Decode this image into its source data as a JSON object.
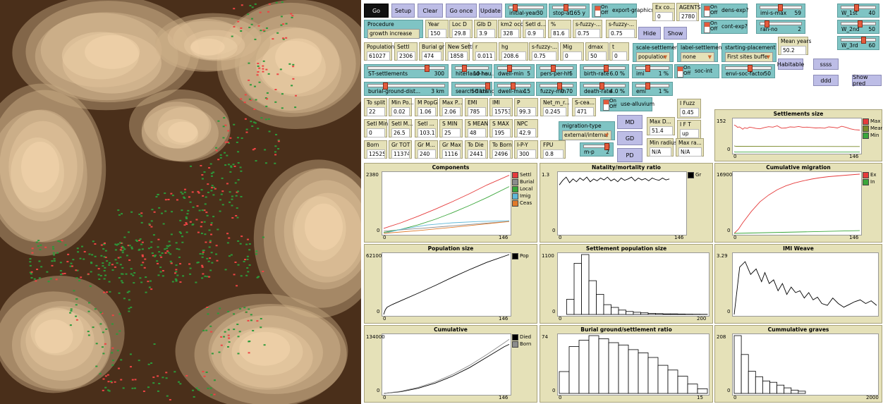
{
  "buttons": {
    "go": "Go",
    "setup": "Setup",
    "clear": "Clear",
    "go_once": "Go once",
    "update": "Update",
    "hide": "Hide",
    "show": "Show",
    "habitable": "Habitable",
    "ssss": "ssss",
    "ddd": "ddd",
    "show_pred": "Show pred",
    "md": "MD",
    "gd": "GD",
    "pd": "PD"
  },
  "switch_labels": {
    "on": "On",
    "off": "Off"
  },
  "sliders": [
    {
      "name": "initial-year",
      "value": "30",
      "frac": 0.1
    },
    {
      "name": "stop-at",
      "value": "165 y",
      "frac": 0.35
    },
    {
      "name": "imi-s-max",
      "value": "59",
      "frac": 0.45
    },
    {
      "name": "ran-no",
      "value": "2",
      "frac": 0.1
    },
    {
      "name": "W_1st",
      "value": "40",
      "frac": 0.4
    },
    {
      "name": "W_2nd",
      "value": "50",
      "frac": 0.5
    },
    {
      "name": "W_3rd",
      "value": "60",
      "frac": 0.6
    },
    {
      "name": "ST-settlements",
      "value": "300",
      "frac": 0.75
    },
    {
      "name": "hiterland-hou...",
      "value": "10 ha",
      "frac": 0.2
    },
    {
      "name": "dwell-min",
      "value": "5",
      "frac": 0.3
    },
    {
      "name": "pers-per-hh",
      "value": "5",
      "frac": 0.35
    },
    {
      "name": "birth-rate",
      "value": "6.0 %",
      "frac": 0.5
    },
    {
      "name": "imi",
      "value": "1 %",
      "frac": 0.3
    },
    {
      "name": "envi-soc-factor",
      "value": "50",
      "frac": 0.5
    },
    {
      "name": "burial-ground-dist...",
      "value": "3 km",
      "frac": 0.2
    },
    {
      "name": "search-distance",
      "value": "50 km",
      "frac": 0.95
    },
    {
      "name": "dwell-max",
      "value": "15",
      "frac": 0.4
    },
    {
      "name": "fuzzy-min",
      "value": "0.70",
      "frac": 0.55
    },
    {
      "name": "death-rate",
      "value": "4.0 %",
      "frac": 0.4
    },
    {
      "name": "emi",
      "value": "1 %",
      "frac": 0.3
    },
    {
      "name": "m-p",
      "value": "2",
      "frac": 0.85
    }
  ],
  "switches": [
    {
      "name": "export-graphics?"
    },
    {
      "name": "dens-exp?"
    },
    {
      "name": "cont-exp?"
    },
    {
      "name": "soc-int"
    },
    {
      "name": "use-alluvium"
    }
  ],
  "choosers": [
    {
      "label": "Procedure",
      "value": "growth increase"
    },
    {
      "label": "scale-settlements",
      "value": "population"
    },
    {
      "label": "label-settlements",
      "value": "none"
    },
    {
      "label": "starting-placement",
      "value": "First sites buffer"
    },
    {
      "label": "migration-type",
      "value": "external/internal"
    }
  ],
  "monitors": [
    {
      "label": "Ex co...",
      "value": "0"
    },
    {
      "label": "AGENTS",
      "value": "2780"
    },
    {
      "label": "Year",
      "value": "150"
    },
    {
      "label": "Loc D",
      "value": "29.8"
    },
    {
      "label": "Glb D",
      "value": "3.9"
    },
    {
      "label": "km2 occ",
      "value": "328"
    },
    {
      "label": "Setl d...",
      "value": "0.9"
    },
    {
      "label": "%",
      "value": "81.6"
    },
    {
      "label": "s-fuzzy-...",
      "value": "0.75"
    },
    {
      "label": "s-fuzzy-...",
      "value": "0.75"
    },
    {
      "label": "Mean years",
      "value": "50.2"
    },
    {
      "label": "Population",
      "value": "61027"
    },
    {
      "label": "Settl",
      "value": "2306"
    },
    {
      "label": "Burial gr",
      "value": "474"
    },
    {
      "label": "New Settl",
      "value": "1858"
    },
    {
      "label": "r",
      "value": "0.011"
    },
    {
      "label": "hg",
      "value": "208.6"
    },
    {
      "label": "s-fuzzy-...",
      "value": "0.75"
    },
    {
      "label": "Mig",
      "value": "0"
    },
    {
      "label": "dmax",
      "value": "50"
    },
    {
      "label": "t",
      "value": "0"
    },
    {
      "label": "I Fuzz",
      "value": "0.45"
    },
    {
      "label": "I F T",
      "value": "up"
    },
    {
      "label": "To split",
      "value": "22"
    },
    {
      "label": "Min Po...",
      "value": "0.02"
    },
    {
      "label": "M PopG",
      "value": "1.06"
    },
    {
      "label": "Max P...",
      "value": "2.06"
    },
    {
      "label": "EMI",
      "value": "785"
    },
    {
      "label": "IMI",
      "value": "15753"
    },
    {
      "label": "P",
      "value": "99.3"
    },
    {
      "label": "Net_m_r...",
      "value": "0.245"
    },
    {
      "label": "S-cea...",
      "value": "471"
    },
    {
      "label": "Setl Min",
      "value": "0"
    },
    {
      "label": "Setl M...",
      "value": "26.5"
    },
    {
      "label": "Setl ...",
      "value": "103.1"
    },
    {
      "label": "S MIN",
      "value": "25"
    },
    {
      "label": "S MEAN",
      "value": "48"
    },
    {
      "label": "S MAX",
      "value": "195"
    },
    {
      "label": "NPC",
      "value": "42.9"
    },
    {
      "label": "Max D...",
      "value": "51.4"
    },
    {
      "label": "Born",
      "value": "125258"
    },
    {
      "label": "Gr TOT",
      "value": "113746"
    },
    {
      "label": "Gr M...",
      "value": "240"
    },
    {
      "label": "Gr Max",
      "value": "1116"
    },
    {
      "label": "To Die",
      "value": "2441"
    },
    {
      "label": "To Born",
      "value": "2496"
    },
    {
      "label": "I-P-Y",
      "value": "300"
    },
    {
      "label": "FPU",
      "value": "0.8"
    },
    {
      "label": "Min radius",
      "value": "N/A"
    },
    {
      "label": "Max ra...",
      "value": "N/A"
    }
  ],
  "chart_data": [
    {
      "id": "settlements-size",
      "title": "Settlements size",
      "type": "line",
      "ymax": "152",
      "y0": "0",
      "x0": "0",
      "xmax": "146",
      "legend": [
        {
          "name": "Max",
          "color": "#e53b3b"
        },
        {
          "name": "Mean",
          "color": "#7a8a2a"
        },
        {
          "name": "Min",
          "color": "#3aa63a"
        }
      ],
      "series": [
        {
          "name": "Max",
          "color": "#e53b3b",
          "x": [
            0,
            2,
            4,
            6,
            8,
            10,
            12,
            15,
            18,
            22,
            25,
            30,
            35,
            40,
            45,
            50,
            55,
            60,
            65,
            70,
            75,
            80,
            85,
            90,
            95,
            100,
            105,
            110,
            115,
            120,
            125,
            130,
            135,
            140,
            146
          ],
          "y": [
            128,
            124,
            117,
            119,
            114,
            108,
            115,
            112,
            118,
            115,
            112,
            110,
            116,
            120,
            118,
            124,
            113,
            114,
            119,
            118,
            121,
            117,
            118,
            116,
            114,
            115,
            113,
            119,
            117,
            114,
            122,
            117,
            110,
            106,
            104
          ]
        },
        {
          "name": "Mean",
          "color": "#7a8a2a",
          "x": [
            0,
            2,
            146
          ],
          "y": [
            30,
            28,
            27
          ]
        },
        {
          "name": "Min",
          "color": "#3aa63a",
          "x": [
            0,
            1,
            146
          ],
          "y": [
            3,
            1,
            1
          ]
        }
      ]
    },
    {
      "id": "components",
      "title": "Components",
      "type": "line",
      "ymax": "2380",
      "y0": "0",
      "x0": "0",
      "xmax": "146",
      "legend": [
        {
          "name": "Settl",
          "color": "#e53b3b"
        },
        {
          "name": "Burial",
          "color": "#8c8c8c"
        },
        {
          "name": "Local",
          "color": "#3aa63a"
        },
        {
          "name": "Imig",
          "color": "#5fb8d8"
        },
        {
          "name": "Ceas",
          "color": "#e07a2a"
        }
      ],
      "series": [
        {
          "name": "Settl",
          "color": "#e53b3b",
          "x": [
            0,
            20,
            40,
            60,
            80,
            100,
            120,
            146
          ],
          "y": [
            200,
            420,
            680,
            960,
            1260,
            1580,
            1920,
            2306
          ]
        },
        {
          "name": "Burial",
          "color": "#8c8c8c",
          "x": [
            0,
            40,
            80,
            120,
            146
          ],
          "y": [
            90,
            190,
            300,
            410,
            474
          ]
        },
        {
          "name": "Local",
          "color": "#3aa63a",
          "x": [
            0,
            20,
            40,
            60,
            80,
            100,
            120,
            146
          ],
          "y": [
            40,
            160,
            340,
            560,
            820,
            1110,
            1420,
            1858
          ]
        },
        {
          "name": "Imig",
          "color": "#5fb8d8",
          "x": [
            0,
            20,
            50,
            80,
            110,
            146
          ],
          "y": [
            0,
            160,
            330,
            420,
            470,
            500
          ]
        },
        {
          "name": "Ceas",
          "color": "#e07a2a",
          "x": [
            0,
            40,
            80,
            120,
            146
          ],
          "y": [
            0,
            110,
            240,
            380,
            471
          ]
        }
      ]
    },
    {
      "id": "natality",
      "title": "Natality/mortality ratio",
      "type": "line",
      "ymax": "1.3",
      "y0": "0",
      "x0": "0",
      "xmax": "146",
      "legend": [
        {
          "name": "Gr",
          "color": "#000000"
        }
      ],
      "series": [
        {
          "name": "Gr",
          "color": "#000000",
          "x": [
            0,
            4,
            8,
            12,
            16,
            20,
            24,
            28,
            32,
            36,
            40,
            44,
            48,
            52,
            56,
            60,
            64,
            68,
            72,
            76,
            80,
            84,
            88,
            92,
            96,
            100,
            104,
            108,
            112,
            116,
            120,
            124,
            128
          ],
          "y": [
            1.05,
            1.15,
            1.22,
            1.1,
            1.18,
            1.12,
            1.2,
            1.15,
            1.22,
            1.12,
            1.18,
            1.14,
            1.2,
            1.16,
            1.22,
            1.14,
            1.18,
            1.12,
            1.2,
            1.15,
            1.18,
            1.22,
            1.14,
            1.2,
            1.16,
            1.19,
            1.14,
            1.2,
            1.17,
            1.15,
            1.2,
            1.16,
            1.18
          ]
        }
      ]
    },
    {
      "id": "cumulative-migration",
      "title": "Cumulative migration",
      "type": "line",
      "ymax": "16900",
      "y0": "0",
      "x0": "0",
      "xmax": "146",
      "legend": [
        {
          "name": "Ex",
          "color": "#e53b3b"
        },
        {
          "name": "In",
          "color": "#3aa63a"
        }
      ],
      "series": [
        {
          "name": "Ex",
          "color": "#e53b3b",
          "x": [
            0,
            5,
            10,
            20,
            30,
            40,
            50,
            60,
            70,
            80,
            90,
            100,
            110,
            120,
            130,
            140,
            146
          ],
          "y": [
            0,
            1200,
            3000,
            6200,
            8900,
            10800,
            12300,
            13400,
            14200,
            14800,
            15300,
            15700,
            16000,
            16200,
            16400,
            16600,
            16700
          ]
        },
        {
          "name": "In",
          "color": "#3aa63a",
          "x": [
            0,
            146
          ],
          "y": [
            0,
            785
          ]
        }
      ]
    },
    {
      "id": "population-size",
      "title": "Population size",
      "type": "line",
      "ymax": "62100",
      "y0": "0",
      "x0": "0",
      "xmax": "146",
      "legend": [
        {
          "name": "Pop",
          "color": "#000000"
        }
      ],
      "series": [
        {
          "name": "Pop",
          "color": "#000000",
          "x": [
            0,
            2,
            4,
            10,
            20,
            40,
            60,
            80,
            100,
            120,
            146
          ],
          "y": [
            0,
            5000,
            7500,
            10300,
            14200,
            22000,
            30000,
            38500,
            46500,
            54000,
            62100
          ]
        }
      ]
    },
    {
      "id": "settlement-pop-size",
      "title": "Settlement population size",
      "type": "hist",
      "ymax": "1100",
      "y0": "0",
      "x0": "0",
      "xmax": "200",
      "bins": [
        0,
        10,
        20,
        30,
        40,
        50,
        60,
        70,
        80,
        90,
        100,
        110,
        120,
        130,
        140,
        150,
        160,
        170,
        180,
        190
      ],
      "values": [
        0,
        280,
        940,
        1100,
        620,
        370,
        180,
        130,
        80,
        55,
        40,
        30,
        20,
        15,
        10,
        10,
        8,
        5,
        4,
        2
      ]
    },
    {
      "id": "imi-weave",
      "title": "IMI Weave",
      "type": "line",
      "ymax": "3.29",
      "y0": "0",
      "x0": "",
      "xmax": "",
      "legend": [],
      "series": [
        {
          "name": "IMI",
          "color": "#000000",
          "x": [
            0,
            5,
            10,
            15,
            20,
            25,
            28,
            32,
            36,
            40,
            44,
            48,
            52,
            56,
            60,
            64,
            68,
            72,
            76,
            80,
            85,
            90,
            95,
            100,
            105,
            110,
            115,
            120,
            125,
            130
          ],
          "y": [
            0,
            2.6,
            2.9,
            2.2,
            2.5,
            1.8,
            2.3,
            1.7,
            1.9,
            1.3,
            1.7,
            1.1,
            1.5,
            1.2,
            1.3,
            0.9,
            1.2,
            0.8,
            0.95,
            0.6,
            0.5,
            0.9,
            0.6,
            0.4,
            0.55,
            0.7,
            0.8,
            0.6,
            0.75,
            0.5
          ]
        }
      ]
    },
    {
      "id": "cumulative",
      "title": "Cumulative",
      "type": "line",
      "ymax": "134000",
      "y0": "0",
      "x0": "0",
      "xmax": "146",
      "legend": [
        {
          "name": "Died",
          "color": "#000000"
        },
        {
          "name": "Born",
          "color": "#8c8c8c"
        }
      ],
      "series": [
        {
          "name": "Died",
          "color": "#000000",
          "x": [
            0,
            20,
            40,
            60,
            80,
            100,
            120,
            140,
            146
          ],
          "y": [
            0,
            4000,
            12000,
            24000,
            40000,
            60000,
            84000,
            108000,
            113746
          ]
        },
        {
          "name": "Born",
          "color": "#8c8c8c",
          "x": [
            0,
            20,
            40,
            60,
            80,
            100,
            120,
            140,
            146
          ],
          "y": [
            0,
            5000,
            14000,
            27000,
            44000,
            65000,
            90000,
            117000,
            125258
          ]
        }
      ]
    },
    {
      "id": "burial-ratio",
      "title": "Burial ground/settlement ratio",
      "type": "hist",
      "ymax": "74",
      "y0": "0",
      "x0": "0",
      "xmax": "15",
      "bins": [
        0,
        1,
        2,
        3,
        4,
        5,
        6,
        7,
        8,
        9,
        10,
        11,
        12,
        13,
        14
      ],
      "values": [
        28,
        60,
        68,
        74,
        70,
        65,
        62,
        56,
        52,
        46,
        36,
        30,
        22,
        12,
        6
      ]
    },
    {
      "id": "cumulative-graves",
      "title": "Cummulative graves",
      "type": "hist",
      "ymax": "208",
      "y0": "0",
      "x0": "0",
      "xmax": "2000",
      "bins": [
        0,
        100,
        200,
        300,
        400,
        500,
        600,
        700,
        800,
        900
      ],
      "values": [
        208,
        140,
        80,
        60,
        45,
        40,
        30,
        20,
        12,
        8
      ]
    }
  ]
}
